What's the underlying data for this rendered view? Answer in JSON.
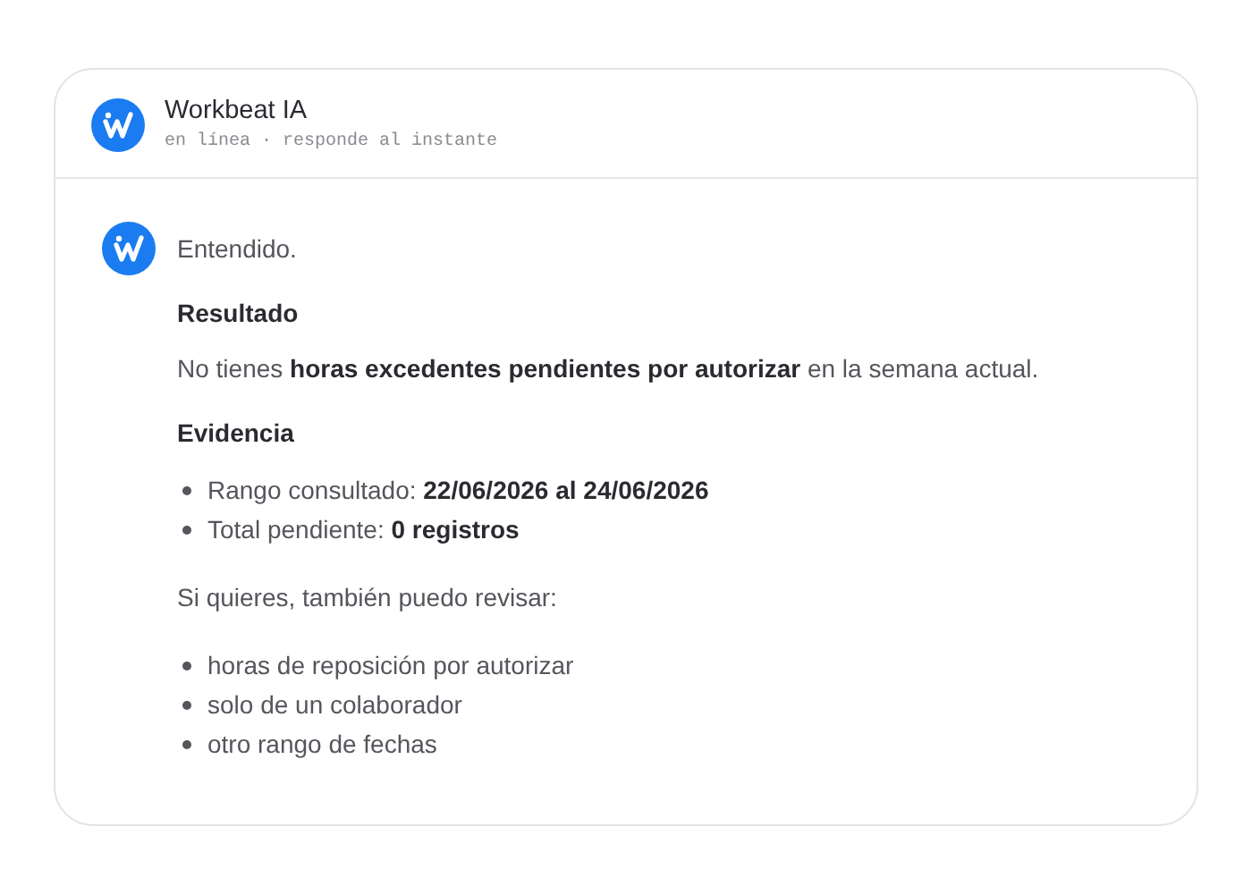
{
  "header": {
    "title": "Workbeat IA",
    "status": "en línea · responde al instante"
  },
  "message": {
    "blocks": [
      {
        "kind": "paragraph",
        "text": "Entendido."
      },
      {
        "kind": "heading",
        "text": "Resultado"
      },
      {
        "kind": "paragraph",
        "text": "No tienes **horas excedentes pendientes por autorizar** en la semana actual."
      },
      {
        "kind": "heading",
        "text": "Evidencia"
      },
      {
        "kind": "list",
        "items": [
          "Rango consultado: **22/06/2026 al 24/06/2026**",
          "Total pendiente: **0 registros**"
        ]
      },
      {
        "kind": "paragraph",
        "text": "Si quieres, también puedo revisar:"
      },
      {
        "kind": "list",
        "items": [
          "horas de reposición por autorizar",
          "solo de un colaborador",
          "otro rango de fechas"
        ]
      }
    ]
  }
}
